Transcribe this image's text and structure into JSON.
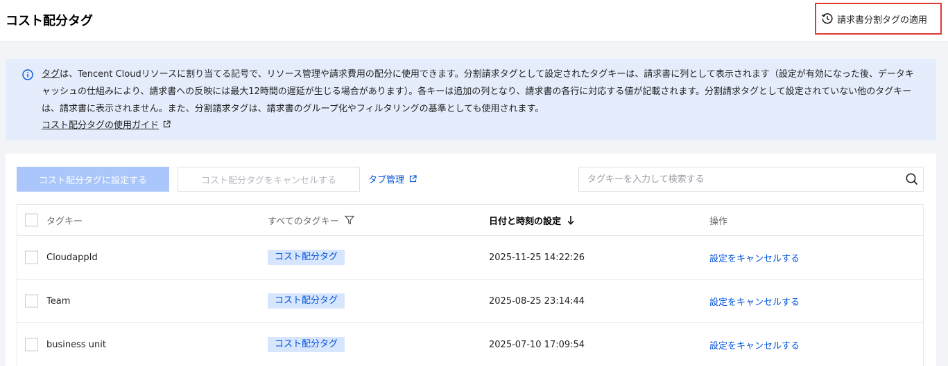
{
  "header": {
    "title": "コスト配分タグ",
    "apply_button": "請求書分割タグの適用"
  },
  "info": {
    "tag_link": "タグ",
    "text": "は、Tencent Cloudリソースに割り当てる記号で、リソース管理や請求費用の配分に使用できます。分割請求タグとして設定されたタグキーは、請求書に列として表示されます（設定が有効になった後、データキャッシュの仕組みにより、請求書への反映には最大12時間の遅延が生じる場合があります）。各キーは追加の列となり、請求書の各行に対応する値が記載されます。分割請求タグとして設定されていない他のタグキーは、請求書に表示されません。また、分割請求タグは、請求書のグループ化やフィルタリングの基準としても使用されます。",
    "guide_link": "コスト配分タグの使用ガイド"
  },
  "toolbar": {
    "set_button": "コスト配分タグに設定する",
    "cancel_button": "コスト配分タグをキャンセルする",
    "tag_manage": "タブ管理",
    "search_placeholder": "タグキーを入力して検索する"
  },
  "table": {
    "columns": {
      "key": "タグキー",
      "all_keys": "すべてのタグキー",
      "date": "日付と時刻の設定",
      "operation": "操作"
    },
    "rows": [
      {
        "key": "CloudappId",
        "type": "コスト配分タグ",
        "date": "2025-11-25 14:22:26",
        "action": "設定をキャンセルする"
      },
      {
        "key": "Team",
        "type": "コスト配分タグ",
        "date": "2025-08-25 23:14:44",
        "action": "設定をキャンセルする"
      },
      {
        "key": "business unit",
        "type": "コスト配分タグ",
        "date": "2025-07-10 17:09:54",
        "action": "設定をキャンセルする"
      }
    ]
  },
  "colors": {
    "accent": "#0052d9",
    "info_bg": "#e5edfc",
    "highlight_border": "#e0362f",
    "disabled_primary": "#aac6fb"
  },
  "icons": {
    "apply": "history-clock-icon",
    "info": "info-circle-icon",
    "external": "external-link-icon",
    "search": "search-icon",
    "filter": "filter-funnel-icon",
    "sort": "arrow-down-icon"
  }
}
